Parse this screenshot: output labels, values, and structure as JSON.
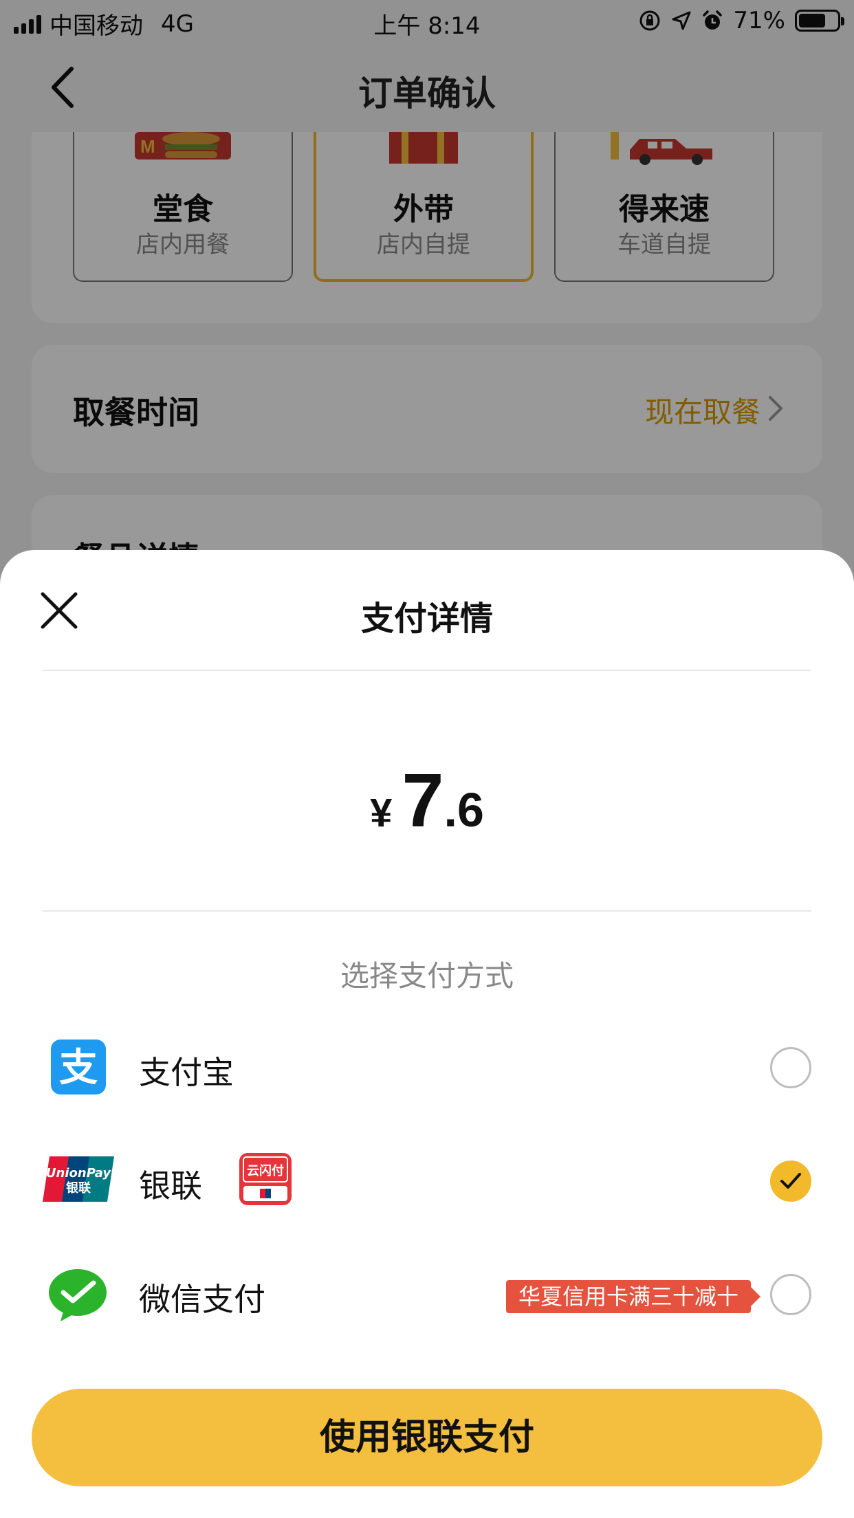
{
  "status_bar": {
    "carrier": "中国移动",
    "network": "4G",
    "time": "上午 8:14",
    "battery": "71%",
    "battery_level": 0.71
  },
  "nav": {
    "title": "订单确认"
  },
  "modes": [
    {
      "name": "堂食",
      "sub": "店内用餐",
      "selected": false
    },
    {
      "name": "外带",
      "sub": "店内自提",
      "selected": true
    },
    {
      "name": "得来速",
      "sub": "车道自提",
      "selected": false
    }
  ],
  "pickup": {
    "label": "取餐时间",
    "value": "现在取餐"
  },
  "details": {
    "title": "餐品详情"
  },
  "sheet": {
    "title": "支付详情",
    "currency": "¥",
    "amount_int": "7",
    "amount_dec": ".6",
    "choose_label": "选择支付方式",
    "methods": [
      {
        "name": "支付宝",
        "icon": "alipay-icon",
        "checked": false
      },
      {
        "name": "银联",
        "icon": "unionpay-icon",
        "extra_icon": "cloud-quickpass-icon",
        "checked": true
      },
      {
        "name": "微信支付",
        "icon": "wechat-pay-icon",
        "promo": "华夏信用卡满三十减十",
        "checked": false
      }
    ],
    "pay_button": "使用银联支付"
  },
  "colors": {
    "accent": "#f4be3e",
    "promo": "#e5523e",
    "alipay": "#1e9bf0",
    "wechat": "#2ab32b"
  }
}
